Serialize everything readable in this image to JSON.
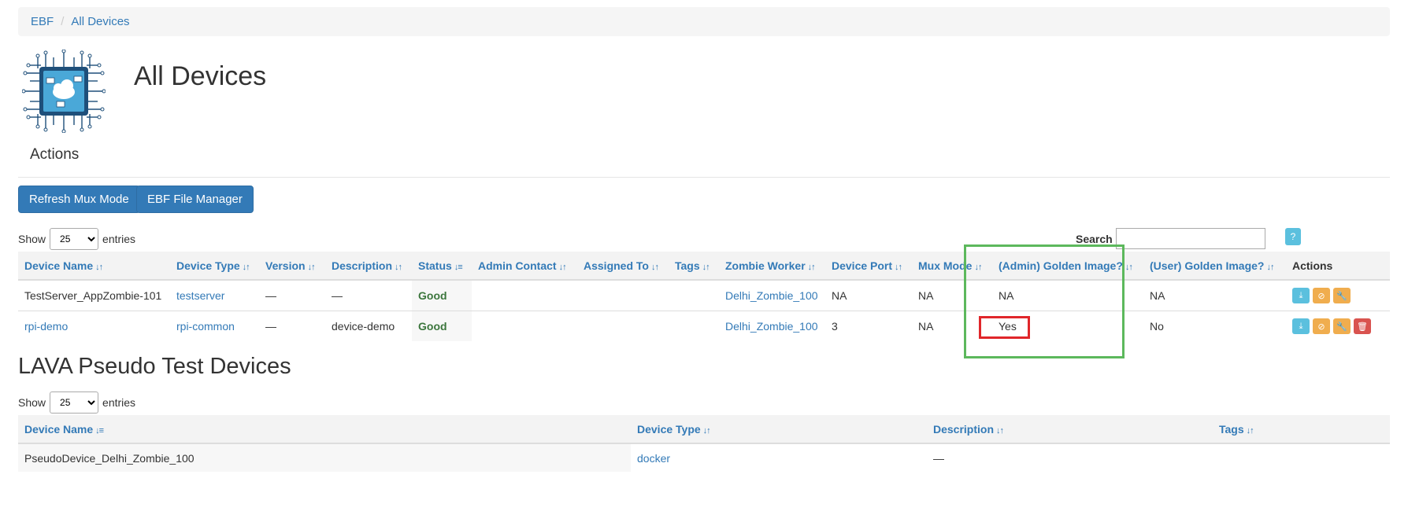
{
  "breadcrumb": {
    "items": [
      "EBF",
      "All Devices"
    ]
  },
  "header": {
    "title": "All Devices"
  },
  "actions_section": {
    "label": "Actions",
    "buttons": {
      "refresh": "Refresh Mux Mode",
      "file_manager": "EBF File Manager"
    }
  },
  "devices_table": {
    "show_label": "Show",
    "entries_value": "25",
    "entries_label": "entries",
    "search_label": "Search",
    "help_label": "?",
    "columns": [
      "Device Name",
      "Device Type",
      "Version",
      "Description",
      "Status",
      "Admin Contact",
      "Assigned To",
      "Tags",
      "Zombie Worker",
      "Device Port",
      "Mux Mode",
      "(Admin) Golden Image?",
      "(User) Golden Image?",
      "Actions"
    ],
    "rows": [
      {
        "device_name": "TestServer_AppZombie-101",
        "device_type": "testserver",
        "version": "—",
        "description": "—",
        "status": "Good",
        "admin_contact": "",
        "assigned_to": "",
        "tags": "",
        "zombie_worker": "Delhi_Zombie_100",
        "device_port": "NA",
        "mux_mode": "NA",
        "admin_golden_image": "NA",
        "user_golden_image": "NA"
      },
      {
        "device_name": "rpi-demo",
        "device_type": "rpi-common",
        "version": "—",
        "description": "device-demo",
        "status": "Good",
        "admin_contact": "",
        "assigned_to": "",
        "tags": "",
        "zombie_worker": "Delhi_Zombie_100",
        "device_port": "3",
        "mux_mode": "NA",
        "admin_golden_image": "Yes",
        "user_golden_image": "No"
      }
    ]
  },
  "pseudo_section": {
    "title": "LAVA Pseudo Test Devices",
    "show_label": "Show",
    "entries_value": "25",
    "entries_label": "entries",
    "columns": [
      "Device Name",
      "Device Type",
      "Description",
      "Tags"
    ],
    "rows": [
      {
        "device_name": "PseudoDevice_Delhi_Zombie_100",
        "device_type": "docker",
        "description": "—",
        "tags": ""
      }
    ]
  },
  "icons": [
    "chip-logo-icon",
    "sort-icon",
    "sort-asc-icon",
    "download-icon",
    "ban-icon",
    "wrench-icon",
    "trash-icon"
  ],
  "colors": {
    "primary": "#337ab7",
    "good": "#3c763d",
    "info": "#5bc0de",
    "warning": "#f0ad4e",
    "danger": "#d9534f",
    "annotation_green": "#5cb85c",
    "annotation_red": "#e0262a"
  }
}
